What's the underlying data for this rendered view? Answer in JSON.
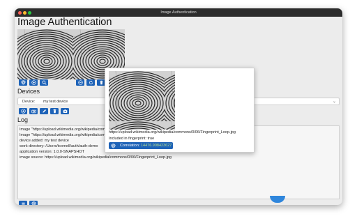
{
  "window": {
    "title": "Image Authentication"
  },
  "header": {
    "title": "Image Authentication"
  },
  "sections": {
    "devices": "Devices",
    "log": "Log"
  },
  "device": {
    "label": "Device:",
    "value": "my test device"
  },
  "log": {
    "lines": [
      "Image \"https://upload.wikimedia.org/wikipedia/commons/0/06/Fingerprint_Loop.jpg\" added to fingerprint",
      "Image \"https://upload.wikimedia.org/wikipedia/commons/0/06/Fingerprint_Loop.jpg\" added to fingerprint",
      "device added: my test device",
      "work directory: /Users/tcornell/auth/auth-demo",
      "application version: 1.0.0-SNAPSHOT",
      "image source: https://upload.wikimedia.org/wikipedia/commons/0/06/Fingerprint_Loop.jpg"
    ]
  },
  "popup": {
    "url": "https://upload.wikimedia.org/wikipedia/commons/0/06/Fingerprint_Loop.jpg",
    "included": "Included in fingerprint: true",
    "correlation_label": "Correlation:",
    "correlation_value": "14476.908423627"
  },
  "colors": {
    "accent": "#1e63b8",
    "correlation": "#b9e08a"
  }
}
